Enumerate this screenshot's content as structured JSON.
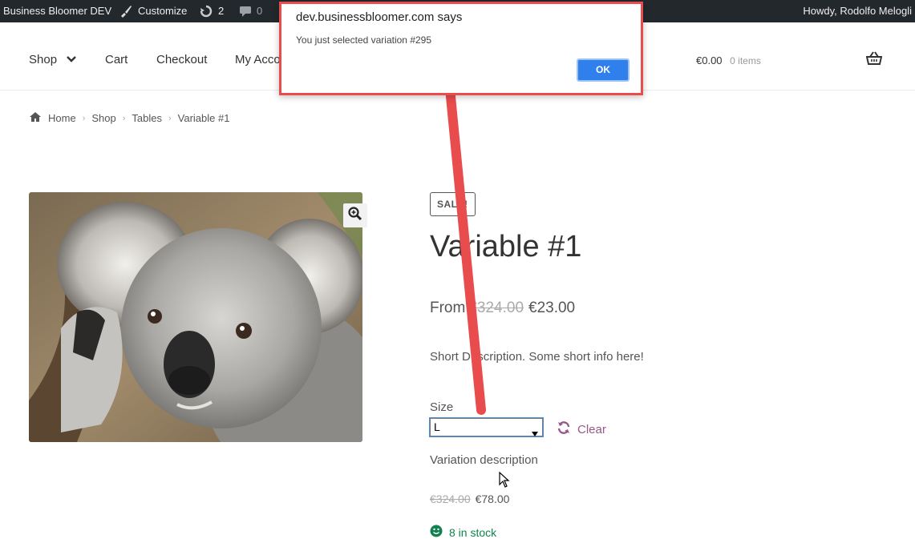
{
  "admin_bar": {
    "site_name": "Business Bloomer DEV",
    "customize_label": "Customize",
    "updates_count": "2",
    "comments_count": "0",
    "greeting": "Howdy, Rodolfo Melogli",
    "icons": [
      "wordpress-icon",
      "brush-icon",
      "updates-icon",
      "comment-icon"
    ]
  },
  "nav": {
    "items": [
      {
        "label": "Shop"
      },
      {
        "label": "Cart"
      },
      {
        "label": "Checkout"
      },
      {
        "label": "My Acco"
      }
    ],
    "cart_total": "€0.00",
    "cart_count": "0 items"
  },
  "breadcrumb": [
    "Home",
    "Shop",
    "Tables",
    "Variable #1"
  ],
  "product": {
    "sale_badge": "SALE!",
    "title": "Variable #1",
    "price_prefix": "From",
    "price_old": "€324.00",
    "price_new": "€23.00",
    "short_description": "Short Description. Some short info here!",
    "size_label": "Size",
    "size_selected": "L",
    "clear_label": "Clear",
    "variation_description": "Variation description",
    "variation_price_old": "€324.00",
    "variation_price_new": "€78.00",
    "stock": "8 in stock"
  },
  "dialog": {
    "title": "dev.businessbloomer.com says",
    "message": "You just selected variation #295",
    "ok_label": "OK"
  },
  "colors": {
    "admin_bar": "#23282d",
    "accent_link": "#96588a",
    "in_stock": "#0f834d",
    "annotation_red": "#e84c4c",
    "ok_button": "#2f80ed"
  }
}
